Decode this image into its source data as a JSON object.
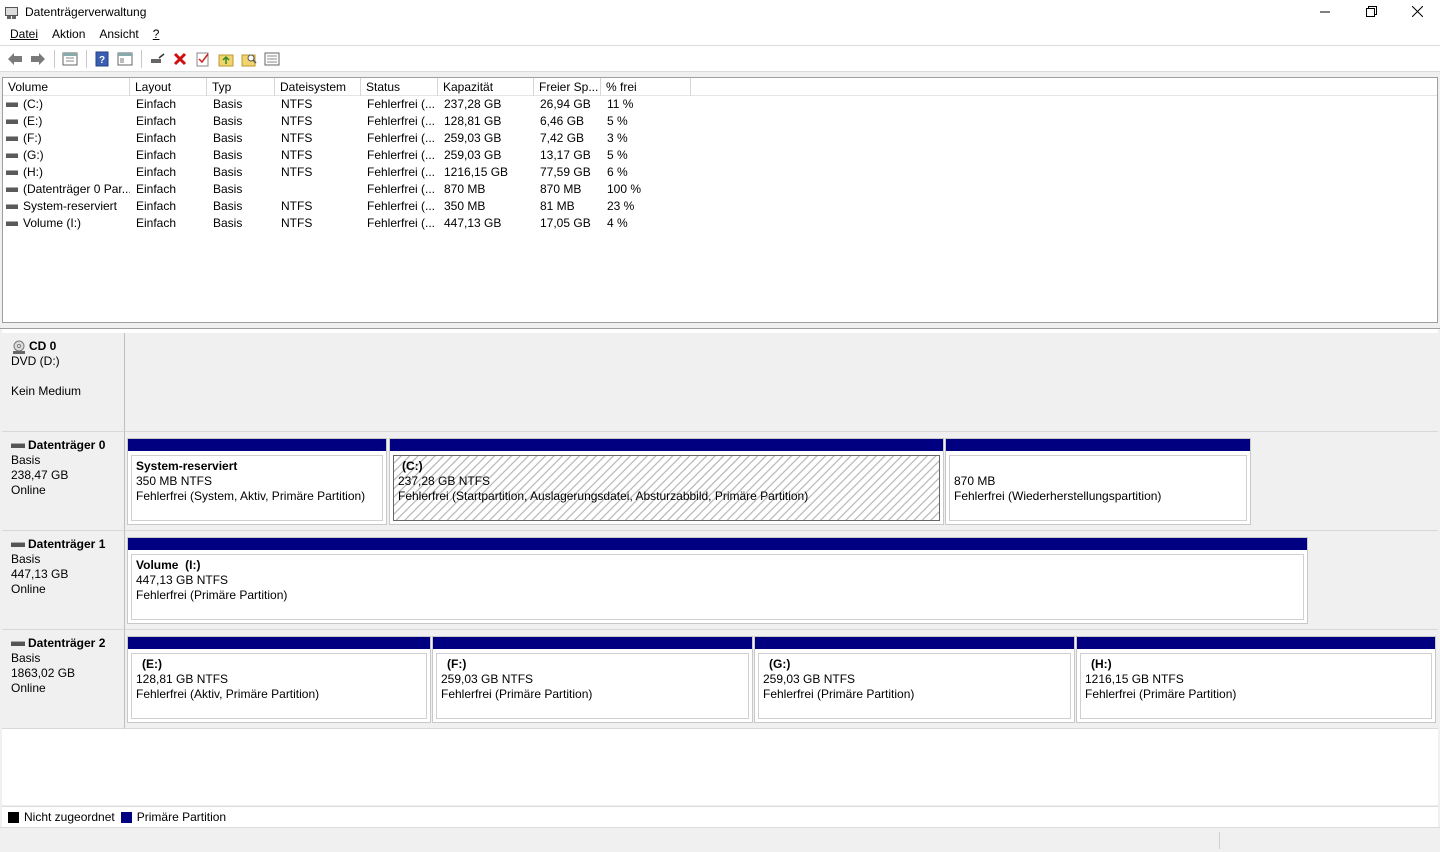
{
  "window": {
    "title": "Datenträgerverwaltung"
  },
  "menu": [
    {
      "label": "Datei"
    },
    {
      "label": "Aktion"
    },
    {
      "label": "Ansicht"
    },
    {
      "label": "?"
    }
  ],
  "toolbar": {
    "buttons": [
      "back-icon",
      "forward-icon",
      "properties-view-icon",
      "help-icon",
      "console-tree-icon",
      "connect-disk-icon",
      "delete-icon",
      "check-icon",
      "up-folder-icon",
      "search-folder-icon",
      "list-view-icon"
    ]
  },
  "volumes": {
    "columns": [
      "Volume",
      "Layout",
      "Typ",
      "Dateisystem",
      "Status",
      "Kapazität",
      "Freier Sp...",
      "% frei"
    ],
    "rows": [
      [
        "(C:)",
        "Einfach",
        "Basis",
        "NTFS",
        "Fehlerfrei (...",
        "237,28 GB",
        "26,94 GB",
        "11 %"
      ],
      [
        "(E:)",
        "Einfach",
        "Basis",
        "NTFS",
        "Fehlerfrei (...",
        "128,81 GB",
        "6,46 GB",
        "5 %"
      ],
      [
        "(F:)",
        "Einfach",
        "Basis",
        "NTFS",
        "Fehlerfrei (...",
        "259,03 GB",
        "7,42 GB",
        "3 %"
      ],
      [
        "(G:)",
        "Einfach",
        "Basis",
        "NTFS",
        "Fehlerfrei (...",
        "259,03 GB",
        "13,17 GB",
        "5 %"
      ],
      [
        "(H:)",
        "Einfach",
        "Basis",
        "NTFS",
        "Fehlerfrei (...",
        "1216,15 GB",
        "77,59 GB",
        "6 %"
      ],
      [
        "(Datenträger 0 Par...",
        "Einfach",
        "Basis",
        "",
        "Fehlerfrei (...",
        "870 MB",
        "870 MB",
        "100 %"
      ],
      [
        "System-reserviert",
        "Einfach",
        "Basis",
        "NTFS",
        "Fehlerfrei (...",
        "350 MB",
        "81 MB",
        "23 %"
      ],
      [
        "Volume (I:)",
        "Einfach",
        "Basis",
        "NTFS",
        "Fehlerfrei (...",
        "447,13 GB",
        "17,05 GB",
        "4 %"
      ]
    ]
  },
  "disks": {
    "cd0": {
      "name": "CD 0",
      "line1": "DVD (D:)",
      "line2": "",
      "line3": "Kein Medium"
    },
    "disk0": {
      "name": "Datenträger 0",
      "type": "Basis",
      "size": "238,47 GB",
      "state": "Online",
      "partitions": [
        {
          "name": "System-reserviert",
          "size": "350 MB NTFS",
          "status": "Fehlerfrei (System, Aktiv, Primäre Partition)"
        },
        {
          "name": "(C:)",
          "size": "237,28 GB NTFS",
          "status": "Fehlerfrei (Startpartition, Auslagerungsdatei, Absturzabbild, Primäre Partition)"
        },
        {
          "name": "",
          "size": "870 MB",
          "status": "Fehlerfrei (Wiederherstellungspartition)"
        }
      ]
    },
    "disk1": {
      "name": "Datenträger 1",
      "type": "Basis",
      "size": "447,13 GB",
      "state": "Online",
      "partitions": [
        {
          "name": "Volume  (I:)",
          "size": "447,13 GB NTFS",
          "status": "Fehlerfrei (Primäre Partition)"
        }
      ]
    },
    "disk2": {
      "name": "Datenträger 2",
      "type": "Basis",
      "size": "1863,02 GB",
      "state": "Online",
      "partitions": [
        {
          "name": "(E:)",
          "size": "128,81 GB NTFS",
          "status": "Fehlerfrei (Aktiv, Primäre Partition)"
        },
        {
          "name": "(F:)",
          "size": "259,03 GB NTFS",
          "status": "Fehlerfrei (Primäre Partition)"
        },
        {
          "name": "(G:)",
          "size": "259,03 GB NTFS",
          "status": "Fehlerfrei (Primäre Partition)"
        },
        {
          "name": "(H:)",
          "size": "1216,15 GB NTFS",
          "status": "Fehlerfrei (Primäre Partition)"
        }
      ]
    }
  },
  "legend": {
    "unallocated": {
      "label": "Nicht zugeordnet",
      "color": "#000000"
    },
    "primary": {
      "label": "Primäre Partition",
      "color": "#000080"
    }
  }
}
